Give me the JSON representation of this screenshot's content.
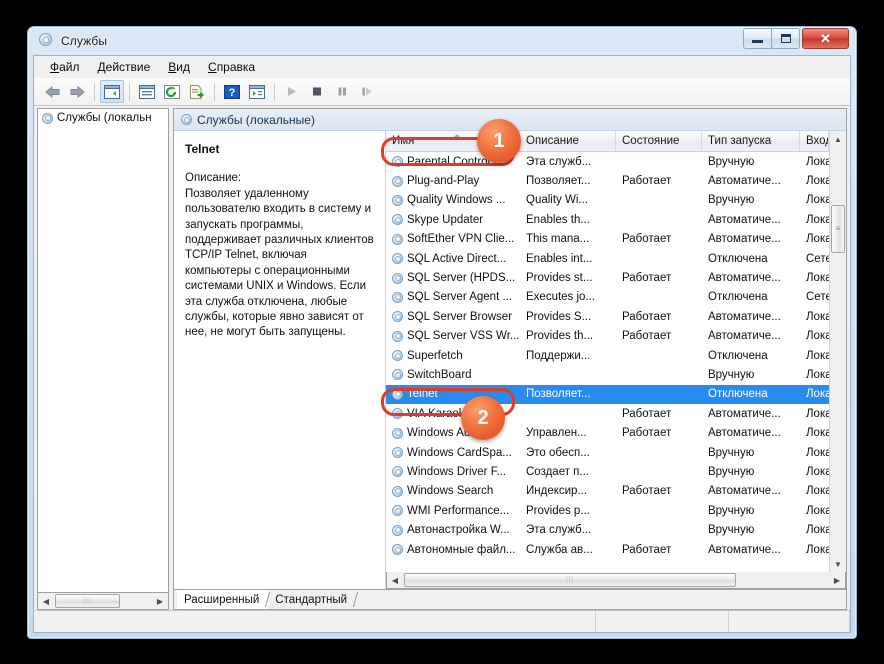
{
  "window": {
    "title": "Службы",
    "icon": "gear-icon",
    "buttons": {
      "minimize": "—",
      "maximize": "❐",
      "close": "✕"
    }
  },
  "menu": {
    "items": [
      {
        "label": "Файл",
        "accel": "Ф"
      },
      {
        "label": "Действие",
        "accel": "Д"
      },
      {
        "label": "Вид",
        "accel": "В"
      },
      {
        "label": "Справка",
        "accel": "С"
      }
    ]
  },
  "toolbar": {
    "items": [
      {
        "name": "back-icon",
        "glyph": "◀"
      },
      {
        "name": "forward-icon",
        "glyph": "▶"
      },
      {
        "name": "show-hide-console-tree-icon",
        "glyph": "▥"
      },
      {
        "name": "properties-icon",
        "glyph": "▤"
      },
      {
        "name": "refresh-icon",
        "glyph": "↻"
      },
      {
        "name": "export-list-icon",
        "glyph": "⇥"
      },
      {
        "name": "help-icon",
        "glyph": "?"
      },
      {
        "name": "show-action-pane-icon",
        "glyph": "▦"
      },
      {
        "name": "start-service-icon",
        "glyph": "▶"
      },
      {
        "name": "stop-service-icon",
        "glyph": "■"
      },
      {
        "name": "pause-service-icon",
        "glyph": "❙❙"
      },
      {
        "name": "restart-service-icon",
        "glyph": "❙▶"
      }
    ]
  },
  "tree": {
    "root_label": "Службы (локальн"
  },
  "detail": {
    "header": "Службы (локальные)",
    "service_title": "Telnet",
    "description_label": "Описание:",
    "description_text": "Позволяет удаленному пользователю входить в систему и запускать программы, поддерживает различных клиентов TCP/IP Telnet, включая компьютеры с операционными системами UNIX и Windows. Если эта служба отключена, любые службы, которые явно зависят от нее, не могут быть запущены."
  },
  "list": {
    "columns": [
      {
        "key": "name",
        "label": "Имя",
        "sorted": "asc"
      },
      {
        "key": "desc",
        "label": "Описание"
      },
      {
        "key": "state",
        "label": "Состояние"
      },
      {
        "key": "start",
        "label": "Тип запуска"
      },
      {
        "key": "logon",
        "label": "Вход от и"
      }
    ],
    "rows": [
      {
        "name": "Parental Controls",
        "desc": "Эта служб...",
        "state": "",
        "start": "Вручную",
        "logon": "Локальна",
        "selected": false
      },
      {
        "name": "Plug-and-Play",
        "desc": "Позволяет...",
        "state": "Работает",
        "start": "Автоматиче...",
        "logon": "Локальна",
        "selected": false
      },
      {
        "name": "Quality Windows ...",
        "desc": "Quality Wi...",
        "state": "",
        "start": "Вручную",
        "logon": "Локальна",
        "selected": false
      },
      {
        "name": "Skype Updater",
        "desc": "Enables th...",
        "state": "",
        "start": "Автоматиче...",
        "logon": "Локальна",
        "selected": false
      },
      {
        "name": "SoftEther VPN Clie...",
        "desc": "This mana...",
        "state": "Работает",
        "start": "Автоматиче...",
        "logon": "Локальна",
        "selected": false
      },
      {
        "name": "SQL Active Direct...",
        "desc": "Enables int...",
        "state": "",
        "start": "Отключена",
        "logon": "Сетевая с",
        "selected": false
      },
      {
        "name": "SQL Server (HPDS...",
        "desc": "Provides st...",
        "state": "Работает",
        "start": "Автоматиче...",
        "logon": "Локальна",
        "selected": false
      },
      {
        "name": "SQL Server Agent ...",
        "desc": "Executes jo...",
        "state": "",
        "start": "Отключена",
        "logon": "Сетевая с",
        "selected": false
      },
      {
        "name": "SQL Server Browser",
        "desc": "Provides S...",
        "state": "Работает",
        "start": "Автоматиче...",
        "logon": "Локальна",
        "selected": false
      },
      {
        "name": "SQL Server VSS Wr...",
        "desc": "Provides th...",
        "state": "Работает",
        "start": "Автоматиче...",
        "logon": "Локальна",
        "selected": false
      },
      {
        "name": "Superfetch",
        "desc": "Поддержи...",
        "state": "",
        "start": "Отключена",
        "logon": "Локальна",
        "selected": false
      },
      {
        "name": "SwitchBoard",
        "desc": "",
        "state": "",
        "start": "Вручную",
        "logon": "Локальна",
        "selected": false
      },
      {
        "name": "Telnet",
        "desc": "Позволяет...",
        "state": "",
        "start": "Отключена",
        "logon": "Локальна",
        "selected": true
      },
      {
        "name": "VIA Karaoke ...",
        "desc": "",
        "state": "Работает",
        "start": "Автоматиче...",
        "logon": "Локальна",
        "selected": false
      },
      {
        "name": "Windows Audio",
        "desc": "Управлен...",
        "state": "Работает",
        "start": "Автоматиче...",
        "logon": "Локальна",
        "selected": false
      },
      {
        "name": "Windows CardSpa...",
        "desc": "Это обесп...",
        "state": "",
        "start": "Вручную",
        "logon": "Локальна",
        "selected": false
      },
      {
        "name": "Windows Driver F...",
        "desc": "Создает п...",
        "state": "",
        "start": "Вручную",
        "logon": "Локальна",
        "selected": false
      },
      {
        "name": "Windows Search",
        "desc": "Индексир...",
        "state": "Работает",
        "start": "Автоматиче...",
        "logon": "Локальна",
        "selected": false
      },
      {
        "name": "WMI Performance...",
        "desc": "Provides p...",
        "state": "",
        "start": "Вручную",
        "logon": "Локальна",
        "selected": false
      },
      {
        "name": "Автонастройка W...",
        "desc": "Эта служб...",
        "state": "",
        "start": "Вручную",
        "logon": "Локальна",
        "selected": false
      },
      {
        "name": "Автономные файл...",
        "desc": "Служба ав...",
        "state": "Работает",
        "start": "Автоматиче...",
        "logon": "Локальна",
        "selected": false
      }
    ]
  },
  "tabs": [
    {
      "label": "Расширенный",
      "active": true
    },
    {
      "label": "Стандартный",
      "active": false
    }
  ],
  "annotations": [
    {
      "name": "name-column-callout",
      "number": "1"
    },
    {
      "name": "telnet-row-callout",
      "number": "2"
    }
  ],
  "colors": {
    "accent": "#2a8bee",
    "annotation": "#e03a2a",
    "badge": "#ef6c35"
  }
}
